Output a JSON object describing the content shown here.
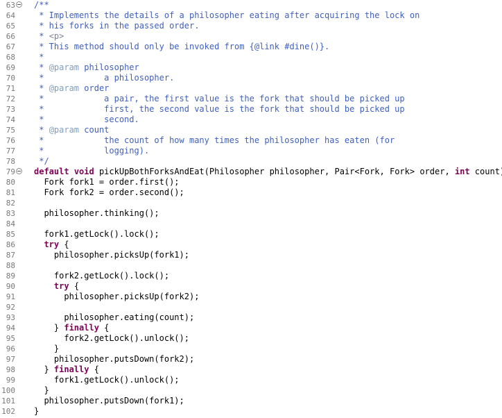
{
  "editor": {
    "lines": [
      {
        "num": "63",
        "fold": true,
        "tokens": [
          {
            "t": "/**",
            "c": "doc"
          }
        ]
      },
      {
        "num": "64",
        "tokens": [
          {
            "t": " * Implements the details of a philosopher eating after acquiring the lock on",
            "c": "doc"
          }
        ]
      },
      {
        "num": "65",
        "tokens": [
          {
            "t": " * his forks in the passed order.",
            "c": "doc"
          }
        ]
      },
      {
        "num": "66",
        "tokens": [
          {
            "t": " * ",
            "c": "doc"
          },
          {
            "t": "<p>",
            "c": "html"
          }
        ]
      },
      {
        "num": "67",
        "tokens": [
          {
            "t": " * This method should only be invoked from {@link #dine()}.",
            "c": "doc"
          }
        ]
      },
      {
        "num": "68",
        "tokens": [
          {
            "t": " *",
            "c": "doc"
          }
        ]
      },
      {
        "num": "69",
        "tokens": [
          {
            "t": " * ",
            "c": "doc"
          },
          {
            "t": "@param",
            "c": "tag"
          },
          {
            "t": " philosopher",
            "c": "doc"
          }
        ]
      },
      {
        "num": "70",
        "tokens": [
          {
            "t": " *            a philosopher.",
            "c": "doc"
          }
        ]
      },
      {
        "num": "71",
        "tokens": [
          {
            "t": " * ",
            "c": "doc"
          },
          {
            "t": "@param",
            "c": "tag"
          },
          {
            "t": " order",
            "c": "doc"
          }
        ]
      },
      {
        "num": "72",
        "tokens": [
          {
            "t": " *            a pair, the first value is the fork that should be picked up",
            "c": "doc"
          }
        ]
      },
      {
        "num": "73",
        "tokens": [
          {
            "t": " *            first, the second value is the fork that should be picked up",
            "c": "doc"
          }
        ]
      },
      {
        "num": "74",
        "tokens": [
          {
            "t": " *            second.",
            "c": "doc"
          }
        ]
      },
      {
        "num": "75",
        "tokens": [
          {
            "t": " * ",
            "c": "doc"
          },
          {
            "t": "@param",
            "c": "tag"
          },
          {
            "t": " count",
            "c": "doc"
          }
        ]
      },
      {
        "num": "76",
        "tokens": [
          {
            "t": " *            the count of how many times the philosopher has eaten (for",
            "c": "doc"
          }
        ]
      },
      {
        "num": "77",
        "tokens": [
          {
            "t": " *            logging).",
            "c": "doc"
          }
        ]
      },
      {
        "num": "78",
        "tokens": [
          {
            "t": " */",
            "c": "doc"
          }
        ]
      },
      {
        "num": "79",
        "fold": true,
        "tokens": [
          {
            "t": "default",
            "c": "kw"
          },
          {
            "t": " ",
            "c": "plain"
          },
          {
            "t": "void",
            "c": "kw"
          },
          {
            "t": " pickUpBothForksAndEat(Philosopher philosopher, Pair<Fork, Fork> order, ",
            "c": "plain"
          },
          {
            "t": "int",
            "c": "kw"
          },
          {
            "t": " count) {",
            "c": "plain"
          }
        ]
      },
      {
        "num": "80",
        "tokens": [
          {
            "t": "  Fork fork1 = order.first();",
            "c": "plain"
          }
        ]
      },
      {
        "num": "81",
        "tokens": [
          {
            "t": "  Fork fork2 = order.second();",
            "c": "plain"
          }
        ]
      },
      {
        "num": "82",
        "tokens": [
          {
            "t": "",
            "c": "plain"
          }
        ]
      },
      {
        "num": "83",
        "tokens": [
          {
            "t": "  philosopher.thinking();",
            "c": "plain"
          }
        ]
      },
      {
        "num": "84",
        "tokens": [
          {
            "t": "",
            "c": "plain"
          }
        ]
      },
      {
        "num": "85",
        "tokens": [
          {
            "t": "  fork1.getLock().lock();",
            "c": "plain"
          }
        ]
      },
      {
        "num": "86",
        "tokens": [
          {
            "t": "  ",
            "c": "plain"
          },
          {
            "t": "try",
            "c": "kw"
          },
          {
            "t": " {",
            "c": "plain"
          }
        ]
      },
      {
        "num": "87",
        "tokens": [
          {
            "t": "    philosopher.picksUp(fork1);",
            "c": "plain"
          }
        ]
      },
      {
        "num": "88",
        "tokens": [
          {
            "t": "",
            "c": "plain"
          }
        ]
      },
      {
        "num": "89",
        "tokens": [
          {
            "t": "    fork2.getLock().lock();",
            "c": "plain"
          }
        ]
      },
      {
        "num": "90",
        "tokens": [
          {
            "t": "    ",
            "c": "plain"
          },
          {
            "t": "try",
            "c": "kw"
          },
          {
            "t": " {",
            "c": "plain"
          }
        ]
      },
      {
        "num": "91",
        "tokens": [
          {
            "t": "      philosopher.picksUp(fork2);",
            "c": "plain"
          }
        ]
      },
      {
        "num": "92",
        "tokens": [
          {
            "t": "",
            "c": "plain"
          }
        ]
      },
      {
        "num": "93",
        "tokens": [
          {
            "t": "      philosopher.eating(count);",
            "c": "plain"
          }
        ]
      },
      {
        "num": "94",
        "tokens": [
          {
            "t": "    } ",
            "c": "plain"
          },
          {
            "t": "finally",
            "c": "kw"
          },
          {
            "t": " {",
            "c": "plain"
          }
        ]
      },
      {
        "num": "95",
        "tokens": [
          {
            "t": "      fork2.getLock().unlock();",
            "c": "plain"
          }
        ]
      },
      {
        "num": "96",
        "tokens": [
          {
            "t": "    }",
            "c": "plain"
          }
        ]
      },
      {
        "num": "97",
        "tokens": [
          {
            "t": "    philosopher.putsDown(fork2);",
            "c": "plain"
          }
        ]
      },
      {
        "num": "98",
        "tokens": [
          {
            "t": "  } ",
            "c": "plain"
          },
          {
            "t": "finally",
            "c": "kw"
          },
          {
            "t": " {",
            "c": "plain"
          }
        ]
      },
      {
        "num": "99",
        "tokens": [
          {
            "t": "    fork1.getLock().unlock();",
            "c": "plain"
          }
        ]
      },
      {
        "num": "100",
        "tokens": [
          {
            "t": "  }",
            "c": "plain"
          }
        ]
      },
      {
        "num": "101",
        "tokens": [
          {
            "t": "  philosopher.putsDown(fork1);",
            "c": "plain"
          }
        ]
      },
      {
        "num": "102",
        "tokens": [
          {
            "t": "}",
            "c": "plain"
          }
        ]
      }
    ]
  },
  "colors": {
    "javadoc": "#3f5fbf",
    "javadoc_tag": "#7f9fbf",
    "html_tag": "#7f7f9f",
    "keyword": "#7f0055",
    "line_number": "#787878"
  }
}
